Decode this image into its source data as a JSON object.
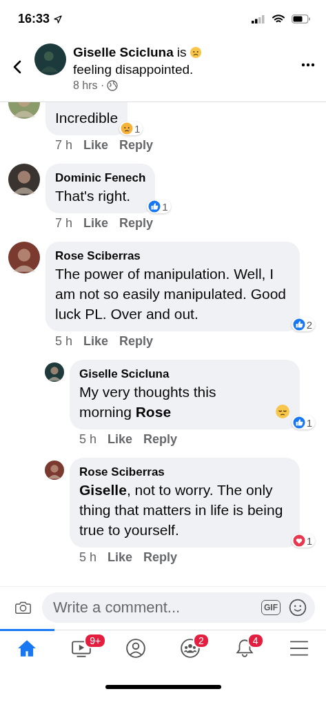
{
  "status_bar": {
    "time": "16:33"
  },
  "header": {
    "name": "Giselle Scicluna",
    "verb": "is",
    "feeling": "feeling disappointed.",
    "time": "8 hrs ·"
  },
  "comments": [
    {
      "reply": false,
      "text": "Incredible",
      "time": "7 h",
      "like": "Like",
      "reply_label": "Reply",
      "reaction": {
        "kind": "sad",
        "count": "1"
      }
    },
    {
      "reply": false,
      "name": "Dominic Fenech",
      "text": "That's right.",
      "time": "7 h",
      "like": "Like",
      "reply_label": "Reply",
      "reaction": {
        "kind": "like",
        "count": "1"
      }
    },
    {
      "reply": false,
      "name": "Rose Sciberras",
      "text": "The power of manipulation. Well, I am not so easily manipulated. Good luck PL. Over and out.",
      "time": "5 h",
      "like": "Like",
      "reply_label": "Reply",
      "reaction": {
        "kind": "like",
        "count": "2"
      }
    },
    {
      "reply": true,
      "name": "Giselle Scicluna",
      "text": "My very thoughts this morning **Rose**",
      "emoji": true,
      "time": "5 h",
      "like": "Like",
      "reply_label": "Reply",
      "reaction": {
        "kind": "like",
        "count": "1"
      }
    },
    {
      "reply": true,
      "name": "Rose Sciberras",
      "text": "**Giselle**, not to worry. The only thing that matters in life is being true to yourself.",
      "time": "5 h",
      "like": "Like",
      "reply_label": "Reply",
      "reaction": {
        "kind": "love",
        "count": "1"
      }
    }
  ],
  "composer": {
    "placeholder": "Write a comment...",
    "gif": "GIF"
  },
  "nav": [
    {
      "kind": "home",
      "selected": true
    },
    {
      "kind": "video",
      "selected": false,
      "badge": "9+"
    },
    {
      "kind": "profile",
      "selected": false
    },
    {
      "kind": "groups",
      "selected": false,
      "badge": "2"
    },
    {
      "kind": "bell",
      "selected": false,
      "badge": "4"
    },
    {
      "kind": "menu",
      "selected": false
    }
  ]
}
